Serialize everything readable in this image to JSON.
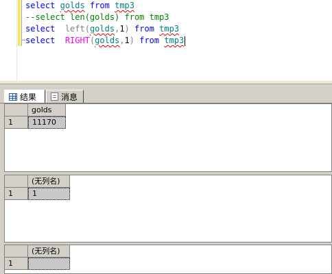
{
  "editor": {
    "lines": [
      {
        "kw1": "select",
        "id1": "golds",
        "kw2": "from",
        "id2": "tmp3"
      },
      {
        "comment": "--select len(golds) from tmp3"
      },
      {
        "kw1": "select",
        "fn": "left",
        "p1": "(",
        "arg": "golds",
        "p2": ",",
        "num": "1",
        "p3": ")",
        "kw2": "from",
        "id2": "tmp3"
      },
      {
        "kw1": "select",
        "fn": "RIGHT",
        "p1": "(",
        "arg": "golds",
        "p2": ",",
        "num": "1",
        "p3": ")",
        "kw2": "from",
        "id2": "tmp3"
      }
    ]
  },
  "tabs": [
    {
      "label": "结果",
      "icon": "grid-icon",
      "active": true
    },
    {
      "label": "消息",
      "icon": "message-icon",
      "active": false
    }
  ],
  "results": [
    {
      "column": "golds",
      "rows": [
        {
          "rownum": "1",
          "value": "11170"
        }
      ]
    },
    {
      "column": "(无列名)",
      "rows": [
        {
          "rownum": "1",
          "value": "1"
        }
      ]
    },
    {
      "column": "(无列名)",
      "rows": [
        {
          "rownum": "1",
          "value": ""
        }
      ]
    }
  ],
  "colors": {
    "keyword": "#0000ff",
    "identifier": "#008080",
    "function": "#ff00ff",
    "comment": "#008000",
    "selected_cell": "#c8c8c8"
  }
}
